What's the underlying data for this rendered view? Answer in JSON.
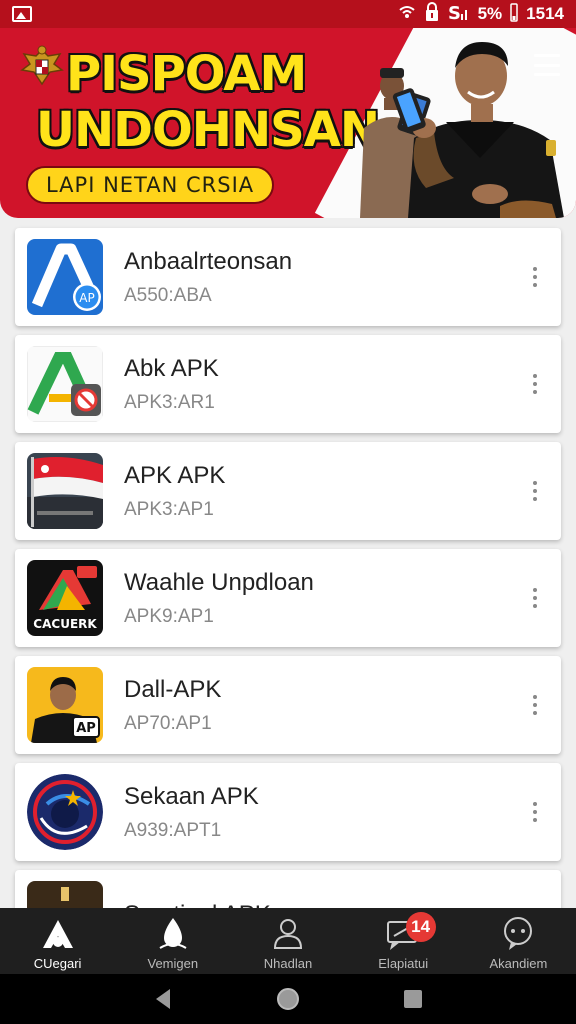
{
  "status_bar": {
    "battery": "5%",
    "time": "1514",
    "icons": [
      "image-icon",
      "wifi-icon",
      "lock-icon",
      "sim-icon",
      "signal-icon",
      "battery-icon"
    ]
  },
  "banner": {
    "title_line1": "PISPOAM",
    "title_line2": "UNDOHNSAN",
    "pill": "LAPI NETAN CRSIA",
    "colors": {
      "red": "#d0142a",
      "yellow": "#ffe31a"
    }
  },
  "apps": [
    {
      "name": "Anbaalrteonsan",
      "sub": "A550:ABA",
      "icon": "blue-a-icon"
    },
    {
      "name": "Abk APK",
      "sub": "APK3:AR1",
      "icon": "green-a-icon"
    },
    {
      "name": "APK APK",
      "sub": "APK3:AP1",
      "icon": "flag-icon"
    },
    {
      "name": "Waahle Unpdloan",
      "sub": "APK9:AP1",
      "icon": "cacuerk-icon"
    },
    {
      "name": "Dall-APK",
      "sub": "AP70:AP1",
      "icon": "person-icon"
    },
    {
      "name": "Sekaan APK",
      "sub": "A939:APT1",
      "icon": "orbit-icon"
    },
    {
      "name": "Scretiaal APK",
      "sub": "",
      "icon": "dome-icon"
    }
  ],
  "icon_texts": {
    "cacuerk": "CACUERK",
    "ap": "AP",
    "ap2": "AP"
  },
  "bottom_nav": [
    {
      "label": "CUegari",
      "icon": "home-icon",
      "active": true
    },
    {
      "label": "Vemigen",
      "icon": "drop-icon",
      "active": false
    },
    {
      "label": "Nhadlan",
      "icon": "user-icon",
      "active": false
    },
    {
      "label": "Elapiatui",
      "icon": "chat-icon",
      "active": false,
      "badge": "14"
    },
    {
      "label": "Akandiem",
      "icon": "message-icon",
      "active": false
    }
  ]
}
